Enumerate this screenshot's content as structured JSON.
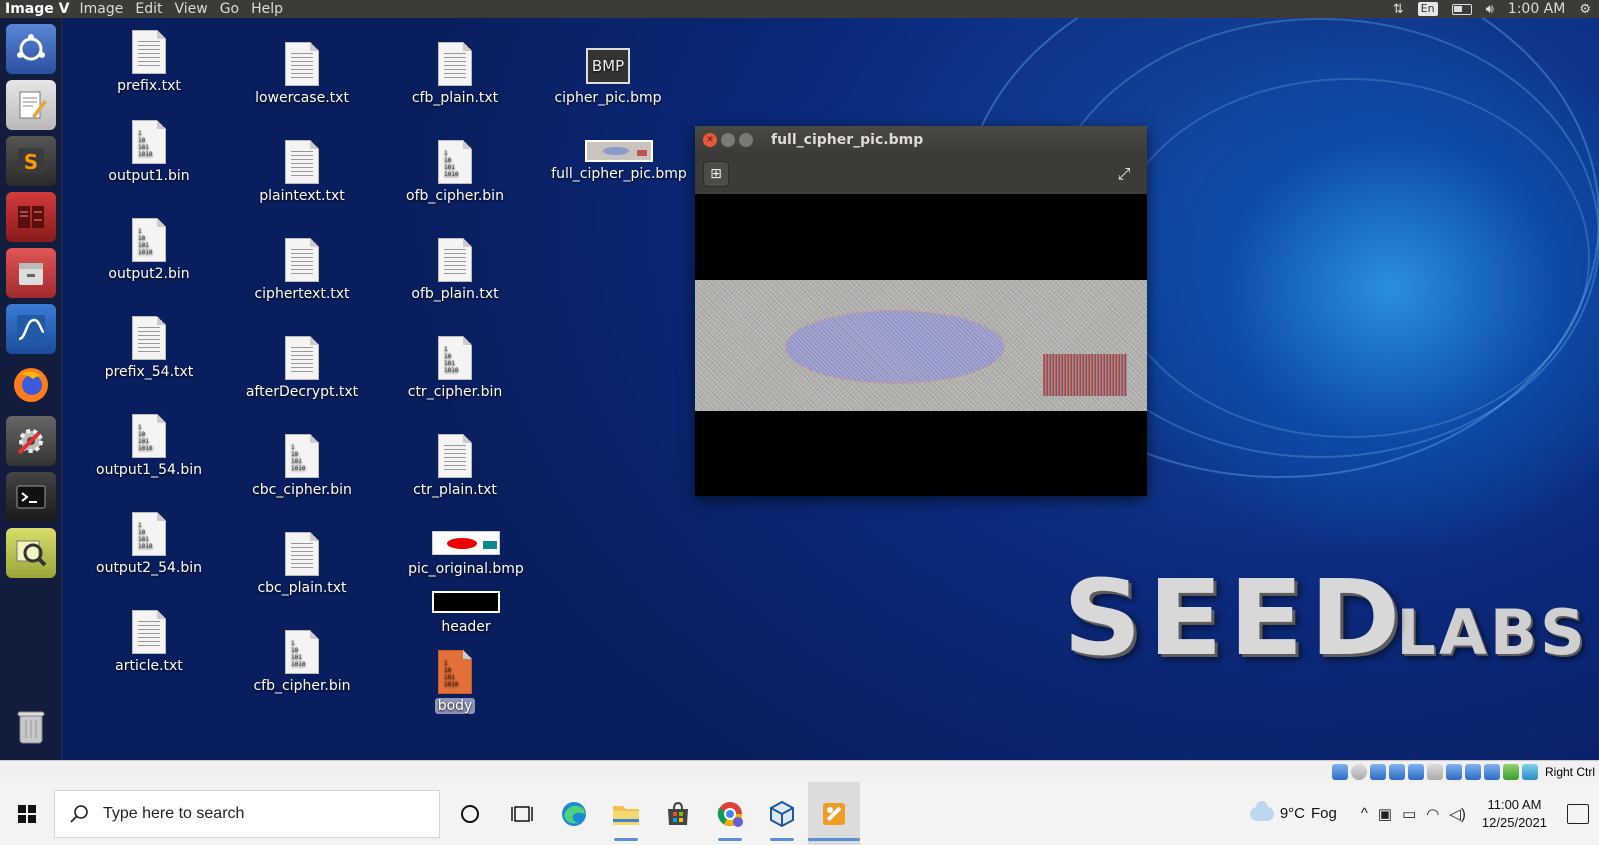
{
  "topbar": {
    "app_name": "Image V",
    "menu": [
      "Image",
      "Edit",
      "View",
      "Go",
      "Help"
    ],
    "keyboard": "En",
    "time": "1:00 AM"
  },
  "desktop_icons": [
    {
      "label": "prefix.txt",
      "kind": "text"
    },
    {
      "label": "output1.bin",
      "kind": "binary"
    },
    {
      "label": "output2.bin",
      "kind": "binary"
    },
    {
      "label": "prefix_54.txt",
      "kind": "text"
    },
    {
      "label": "output1_54.bin",
      "kind": "binary"
    },
    {
      "label": "output2_54.bin",
      "kind": "binary"
    },
    {
      "label": "article.txt",
      "kind": "text"
    },
    {
      "label": "lowercase.txt",
      "kind": "text"
    },
    {
      "label": "plaintext.txt",
      "kind": "text"
    },
    {
      "label": "ciphertext.txt",
      "kind": "text"
    },
    {
      "label": "afterDecrypt.txt",
      "kind": "text"
    },
    {
      "label": "cbc_cipher.bin",
      "kind": "binary"
    },
    {
      "label": "cbc_plain.txt",
      "kind": "text"
    },
    {
      "label": "cfb_cipher.bin",
      "kind": "binary"
    },
    {
      "label": "cfb_plain.txt",
      "kind": "text"
    },
    {
      "label": "ofb_cipher.bin",
      "kind": "binary"
    },
    {
      "label": "ofb_plain.txt",
      "kind": "text"
    },
    {
      "label": "ctr_cipher.bin",
      "kind": "binary"
    },
    {
      "label": "ctr_plain.txt",
      "kind": "text"
    },
    {
      "label": "pic_original.bmp",
      "kind": "image"
    },
    {
      "label": "header",
      "kind": "image-black"
    },
    {
      "label": "body",
      "kind": "binary-orange",
      "selected": true
    },
    {
      "label": "cipher_pic.bmp",
      "kind": "bmp"
    },
    {
      "label": "full_cipher_pic.bmp",
      "kind": "image-thumb"
    }
  ],
  "bmp_badge": "BMP",
  "binary_glyph": [
    "1",
    "10",
    "101",
    "1010"
  ],
  "viewer": {
    "title": "full_cipher_pic.bmp"
  },
  "logo": {
    "big": "SEED",
    "small": "LABS"
  },
  "vbox": {
    "host_key": "Right Ctrl"
  },
  "taskbar": {
    "search_placeholder": "Type here to search",
    "weather_temp": "9°C",
    "weather_text": "Fog",
    "time": "11:00 AM",
    "date": "12/25/2021"
  },
  "colors": {
    "ubuntu_panel": "#3c3b37",
    "desktop_blue": "#0c1f5e",
    "close_button": "#e9573f",
    "taskbar": "#f3f3f3"
  }
}
